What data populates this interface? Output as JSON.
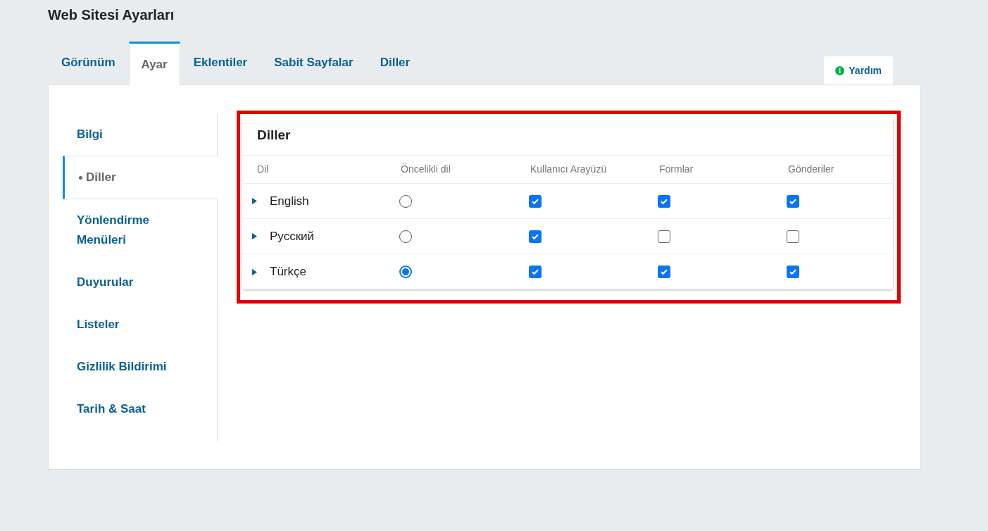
{
  "page": {
    "title": "Web Sitesi Ayarları"
  },
  "tabs": [
    {
      "label": "Görünüm",
      "selected": false
    },
    {
      "label": "Ayar",
      "selected": true
    },
    {
      "label": "Eklentiler",
      "selected": false
    },
    {
      "label": "Sabit Sayfalar",
      "selected": false
    },
    {
      "label": "Diller",
      "selected": false
    }
  ],
  "help_button": {
    "label": "Yardım"
  },
  "sidebar": {
    "items": [
      {
        "label": "Bilgi",
        "selected": false
      },
      {
        "label": "Diller",
        "selected": true
      },
      {
        "label": "Yönlendirme Menüleri",
        "selected": false
      },
      {
        "label": "Duyurular",
        "selected": false
      },
      {
        "label": "Listeler",
        "selected": false
      },
      {
        "label": "Gizlilik Bildirimi",
        "selected": false
      },
      {
        "label": "Tarih & Saat",
        "selected": false
      }
    ]
  },
  "languages_table": {
    "title": "Diller",
    "columns": [
      "Dil",
      "Öncelikli dil",
      "Kullanıcı Arayüzü",
      "Formlar",
      "Gönderiler"
    ],
    "rows": [
      {
        "name": "English",
        "primary": false,
        "checks": [
          true,
          true,
          true
        ]
      },
      {
        "name": "Русский",
        "primary": false,
        "checks": [
          true,
          false,
          false
        ]
      },
      {
        "name": "Türkçe",
        "primary": true,
        "checks": [
          true,
          true,
          true
        ]
      }
    ]
  }
}
